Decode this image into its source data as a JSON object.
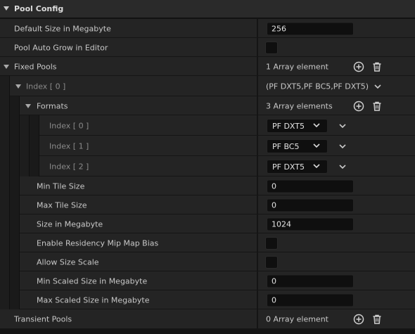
{
  "section": {
    "title": "Pool Config"
  },
  "rows": {
    "default_size": {
      "label": "Default Size in Megabyte",
      "value": "256"
    },
    "auto_grow": {
      "label": "Pool Auto Grow in Editor"
    },
    "fixed_pools": {
      "label": "Fixed Pools",
      "value": "1 Array element"
    },
    "index0": {
      "label": "Index [ 0 ]",
      "value": "(PF DXT5,PF BC5,PF DXT5)"
    },
    "formats": {
      "label": "Formats",
      "value": "3 Array elements"
    },
    "format_items": [
      {
        "label": "Index [ 0 ]",
        "value": "PF DXT5"
      },
      {
        "label": "Index [ 1 ]",
        "value": "PF BC5"
      },
      {
        "label": "Index [ 2 ]",
        "value": "PF DXT5"
      }
    ],
    "min_tile": {
      "label": "Min Tile Size",
      "value": "0"
    },
    "max_tile": {
      "label": "Max Tile Size",
      "value": "0"
    },
    "size_mb": {
      "label": "Size in Megabyte",
      "value": "1024"
    },
    "residency": {
      "label": "Enable Residency Mip Map Bias"
    },
    "allow_scale": {
      "label": "Allow Size Scale"
    },
    "min_scaled": {
      "label": "Min Scaled Size in Megabyte",
      "value": "0"
    },
    "max_scaled": {
      "label": "Max Scaled Size in Megabyte",
      "value": "0"
    },
    "transient": {
      "label": "Transient Pools",
      "value": "0 Array element"
    }
  },
  "icons": {
    "add": "plus-circle-icon",
    "delete": "trash-icon",
    "expand": "chevron-down-icon"
  },
  "colors": {
    "background": "#151515",
    "row": "#242424",
    "header": "#2a2a2a",
    "input": "#0f0f0f"
  }
}
